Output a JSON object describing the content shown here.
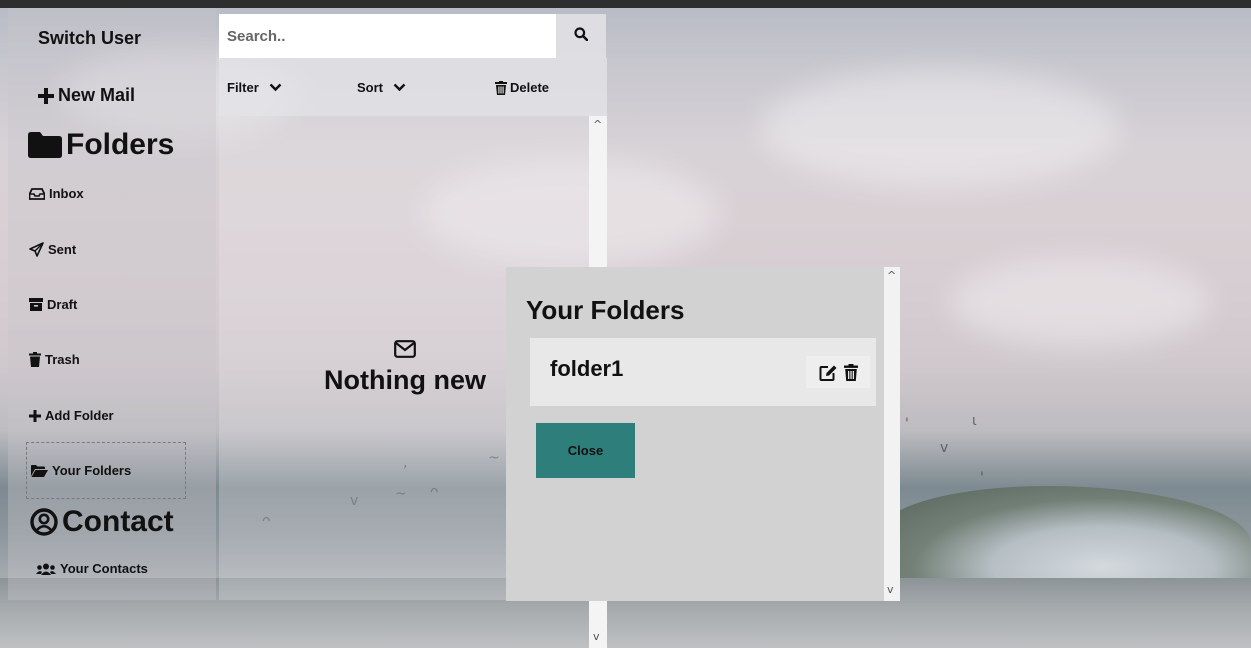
{
  "sidebar": {
    "switch_user": "Switch User",
    "new_mail": "New Mail",
    "folders_heading": "Folders",
    "items": [
      {
        "label": "Inbox"
      },
      {
        "label": "Sent"
      },
      {
        "label": "Draft"
      },
      {
        "label": "Trash"
      },
      {
        "label": "Add Folder"
      },
      {
        "label": "Your Folders"
      }
    ],
    "contact_heading": "Contact",
    "your_contacts": "Your Contacts"
  },
  "search": {
    "placeholder": "Search..",
    "value": ""
  },
  "toolbar": {
    "filter_label": "Filter",
    "sort_label": "Sort",
    "delete_label": "Delete"
  },
  "mail_list": {
    "empty_text": "Nothing new"
  },
  "modal": {
    "title": "Your Folders",
    "folders": [
      {
        "name": "folder1"
      }
    ],
    "close_label": "Close"
  },
  "icons": {
    "search": "search-icon",
    "plus": "plus-icon",
    "folder": "folder-icon",
    "inbox": "inbox-icon",
    "sent": "paper-plane-icon",
    "draft": "archive-icon",
    "trash": "trash-icon",
    "folder_open": "folder-open-icon",
    "user_circle": "user-circle-icon",
    "users": "users-icon",
    "chevron_down": "chevron-down-icon",
    "envelope": "envelope-icon",
    "edit": "edit-icon"
  },
  "colors": {
    "close_button": "#2e7f7b",
    "modal_bg": "#d2d2d2",
    "folder_row_bg": "#e8e8e8"
  }
}
